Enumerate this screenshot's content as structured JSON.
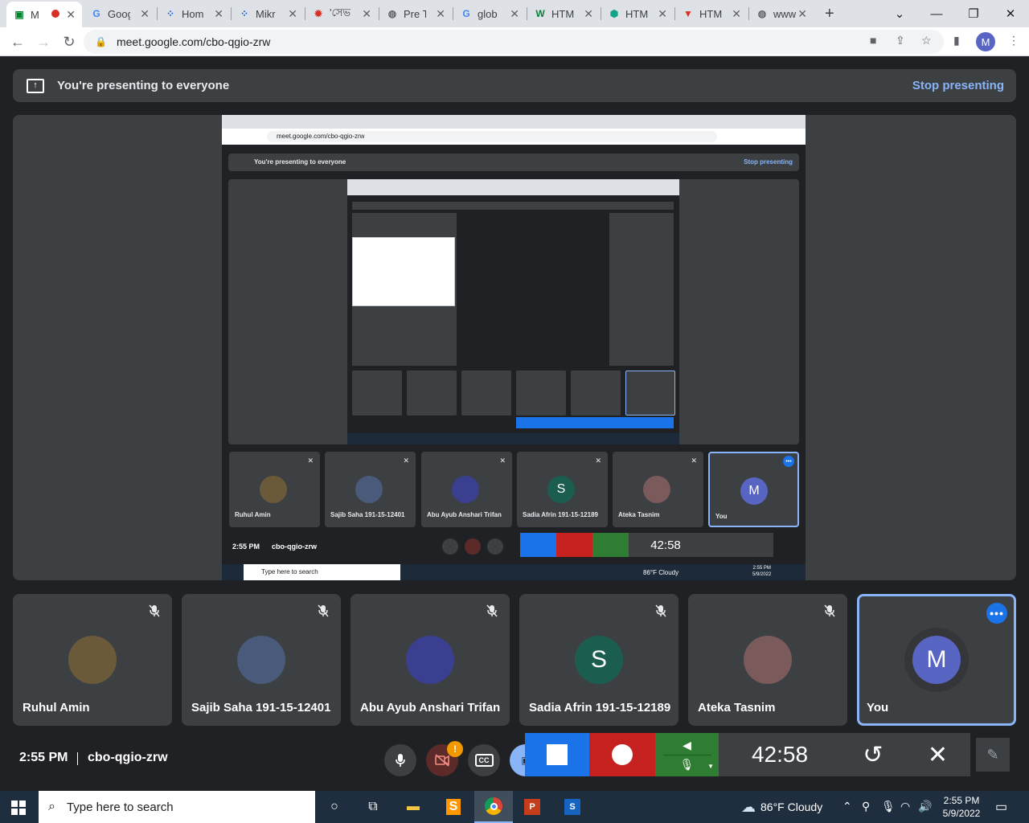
{
  "browser": {
    "tabs": [
      {
        "label": "M",
        "favicon": "meet-icon",
        "active": true
      },
      {
        "label": "Goog",
        "favicon": "google-icon"
      },
      {
        "label": "Hom",
        "favicon": "grid-icon"
      },
      {
        "label": "Mikr",
        "favicon": "grid-icon"
      },
      {
        "label": "'সেভ",
        "favicon": "virus-icon"
      },
      {
        "label": "Pre T",
        "favicon": "globe-icon"
      },
      {
        "label": "glob",
        "favicon": "google-icon"
      },
      {
        "label": "HTM",
        "favicon": "w-icon"
      },
      {
        "label": "HTM",
        "favicon": "hex-icon"
      },
      {
        "label": "HTM",
        "favicon": "v-icon"
      },
      {
        "label": "www",
        "favicon": "globe-icon"
      }
    ],
    "url": "meet.google.com/cbo-qgio-zrw",
    "profile_initial": "M"
  },
  "meet": {
    "banner_text": "You're presenting to everyone",
    "stop_label": "Stop presenting",
    "time": "2:55 PM",
    "meeting_code": "cbo-qgio-zrw",
    "cc_label": "CC",
    "notification_badge": "!",
    "participants": [
      {
        "name": "Ruhul Amin",
        "avatar_color": "#6b5a3a"
      },
      {
        "name": "Sajib Saha 191-15-12401",
        "avatar_color": "#4a5a7a"
      },
      {
        "name": "Abu Ayub Anshari Trifan",
        "avatar_color": "#3b3f8f"
      },
      {
        "name": "Sadia Afrin 191-15-12189",
        "initial": "S",
        "avatar_color": "#1b5e4f"
      },
      {
        "name": "Ateka Tasnim",
        "avatar_color": "#7a5a5a"
      },
      {
        "name": "You",
        "initial": "M",
        "avatar_color": "#5865c3"
      }
    ]
  },
  "recorder": {
    "timer": "42:58",
    "colors": {
      "stop": "#1a73e8",
      "record": "#c5221f",
      "audio": "#2e7d32",
      "timer_bg": "#3c4043"
    }
  },
  "shared_screen": {
    "url": "meet.google.com/cbo-qgio-zrw",
    "banner_text": "You're presenting to everyone",
    "stop_label": "Stop presenting",
    "time": "2:55 PM",
    "meeting_code": "cbo-qgio-zrw",
    "timer": "42:58",
    "search_text": "Type here to search",
    "weather": "86°F  Cloudy",
    "clock_time": "2:55 PM",
    "clock_date": "5/9/2022",
    "participants": [
      "Ruhul Amin",
      "Sajib Saha 191-15-12401",
      "Abu Ayub Anshari Trifan",
      "Sadia Afrin 191-15-12189",
      "Ateka Tasnim",
      "You"
    ]
  },
  "taskbar": {
    "search_placeholder": "Type here to search",
    "weather": "86°F  Cloudy",
    "time": "2:55 PM",
    "date": "5/9/2022"
  }
}
